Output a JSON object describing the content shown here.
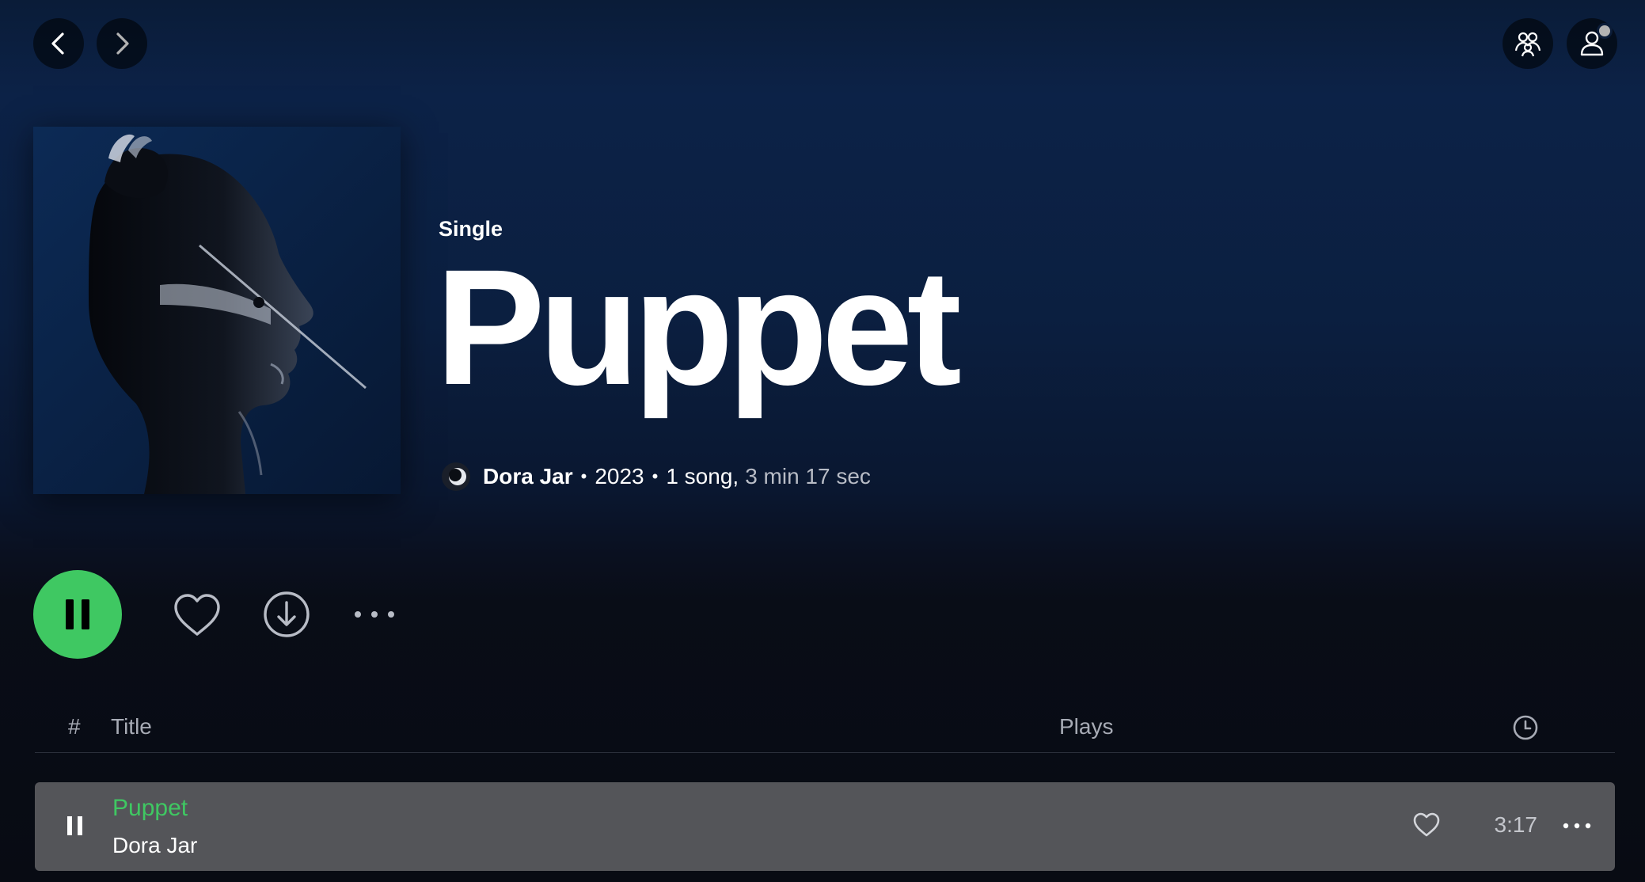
{
  "nav": {
    "back_label": "Back",
    "forward_label": "Forward"
  },
  "topbar": {
    "friends_icon": "friends-icon",
    "profile_icon": "user-icon"
  },
  "album": {
    "type": "Single",
    "title": "Puppet",
    "artist": "Dora Jar",
    "year": "2023",
    "song_count": "1 song,",
    "duration": "3 min 17 sec"
  },
  "actions": {
    "play_state": "playing",
    "icons": [
      "pause-icon",
      "heart-icon",
      "download-icon",
      "more-icon"
    ]
  },
  "tracklist": {
    "headers": {
      "number": "#",
      "title": "Title",
      "plays": "Plays",
      "duration_icon": "clock-icon"
    },
    "tracks": [
      {
        "title": "Puppet",
        "artist": "Dora Jar",
        "duration": "3:17",
        "state": "playing"
      }
    ]
  },
  "colors": {
    "accent": "#3fc862",
    "background_top": "#0c2247",
    "background_bottom": "#080b13",
    "row_highlight": "#545559"
  }
}
